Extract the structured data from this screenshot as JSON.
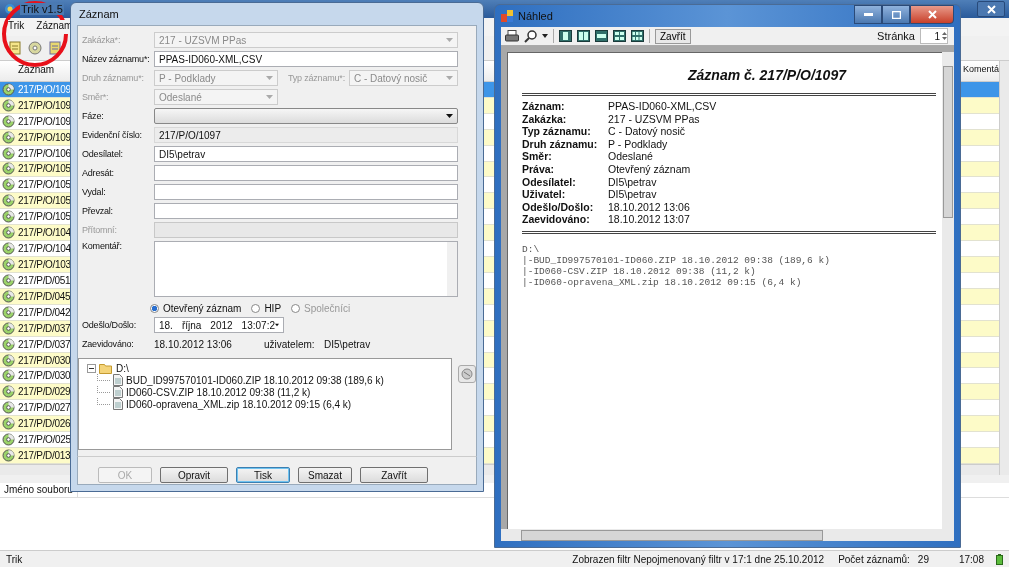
{
  "main": {
    "title": "Trik v1.5",
    "menu": [
      {
        "label": "Trik"
      },
      {
        "label": "Záznam"
      }
    ],
    "list": {
      "columns": [
        "Záznam",
        "Komentá"
      ],
      "rows": [
        {
          "record": "217/P/O/109",
          "selected": true
        },
        {
          "record": "217/P/O/109",
          "selected": false
        },
        {
          "record": "217/P/O/109",
          "selected": false
        },
        {
          "record": "217/P/O/109",
          "selected": false
        },
        {
          "record": "217/P/O/106",
          "selected": false
        },
        {
          "record": "217/P/O/105",
          "selected": false
        },
        {
          "record": "217/P/O/105",
          "selected": false
        },
        {
          "record": "217/P/O/105",
          "selected": false
        },
        {
          "record": "217/P/O/105",
          "selected": false
        },
        {
          "record": "217/P/O/104",
          "selected": false
        },
        {
          "record": "217/P/O/104",
          "selected": false
        },
        {
          "record": "217/P/O/103",
          "selected": false
        },
        {
          "record": "217/P/D/051",
          "selected": false
        },
        {
          "record": "217/P/D/045",
          "selected": false
        },
        {
          "record": "217/P/D/042",
          "selected": false
        },
        {
          "record": "217/P/D/037",
          "selected": false
        },
        {
          "record": "217/P/D/037",
          "selected": false
        },
        {
          "record": "217/P/D/030",
          "selected": false
        },
        {
          "record": "217/P/D/030",
          "selected": false
        },
        {
          "record": "217/P/D/029",
          "selected": false
        },
        {
          "record": "217/P/D/027",
          "selected": false
        },
        {
          "record": "217/P/D/026",
          "selected": false
        },
        {
          "record": "217/P/O/025",
          "selected": false
        },
        {
          "record": "217/P/D/013",
          "selected": false
        }
      ]
    },
    "files_panel": {
      "column": "Jméno souboru"
    },
    "status_bar": {
      "app": "Trik",
      "filter": "Zobrazen filtr Nepojmenovaný filtr v 17:1 dne 25.10.2012",
      "count_label": "Počet záznamů:",
      "count": "29",
      "time": "17:08"
    }
  },
  "record_dialog": {
    "title": "Záznam",
    "fields": [
      {
        "label": "Zakázka*:",
        "value": "217 - UZSVM PPas",
        "kind": "dropdown",
        "disabled": true
      },
      {
        "label": "Název záznamu*:",
        "value": "PPAS-ID060-XML,CSV",
        "kind": "text",
        "disabled": false
      },
      {
        "label": "Druh záznamu*:",
        "value": "P - Podklady",
        "kind": "dropdown",
        "disabled": true,
        "side": {
          "label": "Typ záznamu*:",
          "value": "C - Datový nosič",
          "disabled": true
        }
      },
      {
        "label": "Směr*:",
        "value": "Odeslané",
        "kind": "dropdown",
        "disabled": true
      },
      {
        "label": "Fáze:",
        "kind": "combo",
        "disabled": false
      },
      {
        "label": "Evidenční číslo:",
        "value": "217/P/O/1097",
        "kind": "readonly",
        "disabled": false
      },
      {
        "label": "Odesílatel:",
        "value": "DI5\\petrav",
        "kind": "text",
        "disabled": false
      },
      {
        "label": "Adresát:",
        "kind": "text",
        "disabled": false
      },
      {
        "label": "Vydal:",
        "kind": "text",
        "disabled": false
      },
      {
        "label": "Převzal:",
        "kind": "text",
        "disabled": false
      },
      {
        "label": "Přítomní:",
        "kind": "readonly",
        "disabled": true
      },
      {
        "label": "Komentář:",
        "kind": "memo",
        "disabled": false
      }
    ],
    "radios": [
      {
        "label": "Otevřený záznam",
        "selected": true,
        "disabled": false
      },
      {
        "label": "HIP",
        "selected": false,
        "disabled": false
      },
      {
        "label": "Společníci",
        "selected": false,
        "disabled": true
      }
    ],
    "date": {
      "label": "Odešlo/Došlo:",
      "day": "18.",
      "month": "října",
      "year": "2012",
      "time": "13:07:2"
    },
    "registered": {
      "label": "Zaevidováno:",
      "value": "18.10.2012 13:06",
      "user_label": "uživatelem:",
      "user": "DI5\\petrav"
    },
    "tree": {
      "label": "D:\\",
      "expanded": true,
      "children": [
        {
          "label": "BUD_ID997570101-ID060.ZIP 18.10.2012 09:38 (189,6 k)"
        },
        {
          "label": "ID060-CSV.ZIP 18.10.2012 09:38 (11,2 k)"
        },
        {
          "label": "ID060-opravena_XML.zip 18.10.2012 09:15 (6,4 k)"
        }
      ]
    },
    "buttons": [
      {
        "label": "OK",
        "disabled": true,
        "default": false
      },
      {
        "label": "Opravit",
        "disabled": false,
        "default": false
      },
      {
        "label": "Tisk",
        "disabled": false,
        "default": true
      },
      {
        "label": "Smazat",
        "disabled": false,
        "default": false
      },
      {
        "label": "Zavřít",
        "disabled": false,
        "default": false
      }
    ]
  },
  "preview": {
    "title": "Náhled",
    "close_button": "Zavřít",
    "page_label": "Stránka",
    "page": "1",
    "document": {
      "heading": "Záznam č. 217/P/O/1097",
      "fields": [
        {
          "label": "Záznam:",
          "value": "PPAS-ID060-XML,CSV"
        },
        {
          "label": "Zakázka:",
          "value": "217 - UZSVM PPas"
        },
        {
          "label": "Typ záznamu:",
          "value": "C - Datový nosič"
        },
        {
          "label": "Druh záznamu:",
          "value": "P - Podklady"
        },
        {
          "label": "Směr:",
          "value": "Odeslané"
        },
        {
          "label": "Práva:",
          "value": "Otevřený záznam"
        },
        {
          "label": "Odesílatel:",
          "value": "DI5\\petrav"
        },
        {
          "label": "Uživatel:",
          "value": "DI5\\petrav"
        },
        {
          "label": "Odešlo/Došlo:",
          "value": "18.10.2012 13:06"
        },
        {
          "label": "Zaevidováno:",
          "value": "18.10.2012 13:07"
        }
      ],
      "listing": [
        "D:\\",
        "|-BUD_ID997570101-ID060.ZIP 18.10.2012 09:38 (189,6 k)",
        "|-ID060-CSV.ZIP 18.10.2012 09:38 (11,2 k)",
        "|-ID060-opravena_XML.zip 18.10.2012 09:15 (6,4 k)"
      ]
    }
  }
}
